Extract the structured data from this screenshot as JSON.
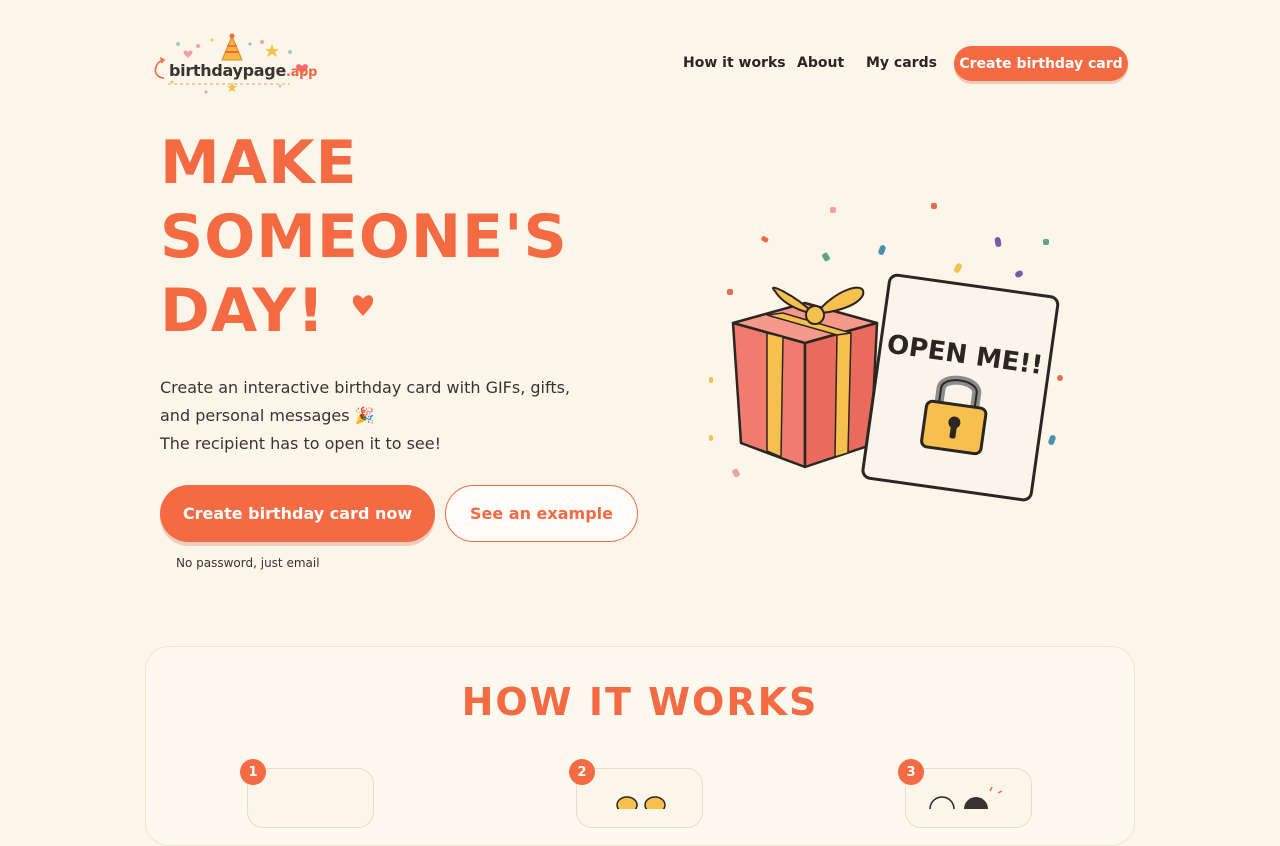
{
  "logo": {
    "name": "birthdaypage",
    "tld": ".app"
  },
  "nav": {
    "links": [
      "How it works",
      "About",
      "My cards"
    ],
    "cta": "Create birthday card"
  },
  "hero": {
    "title_lines": [
      "MAKE",
      "SOMEONE'S",
      "DAY!"
    ],
    "description_lines": [
      "Create an interactive birthday card with GIFs, gifts,",
      "and personal messages 🎉",
      "The recipient has to open it to see!"
    ],
    "primary_button": "Create birthday card now",
    "secondary_button": "See an example",
    "note": "No password, just email"
  },
  "illustration": {
    "card_text": "OPEN ME!!",
    "icons": [
      "gift-box-icon",
      "padlock-icon",
      "confetti-icon"
    ]
  },
  "how_it_works": {
    "title": "HOW IT WORKS",
    "steps": [
      "1",
      "2",
      "3"
    ]
  },
  "colors": {
    "accent": "#f46a43",
    "background": "#fcf6ea",
    "gift": "#f07b6e",
    "ribbon": "#f6c04e"
  }
}
